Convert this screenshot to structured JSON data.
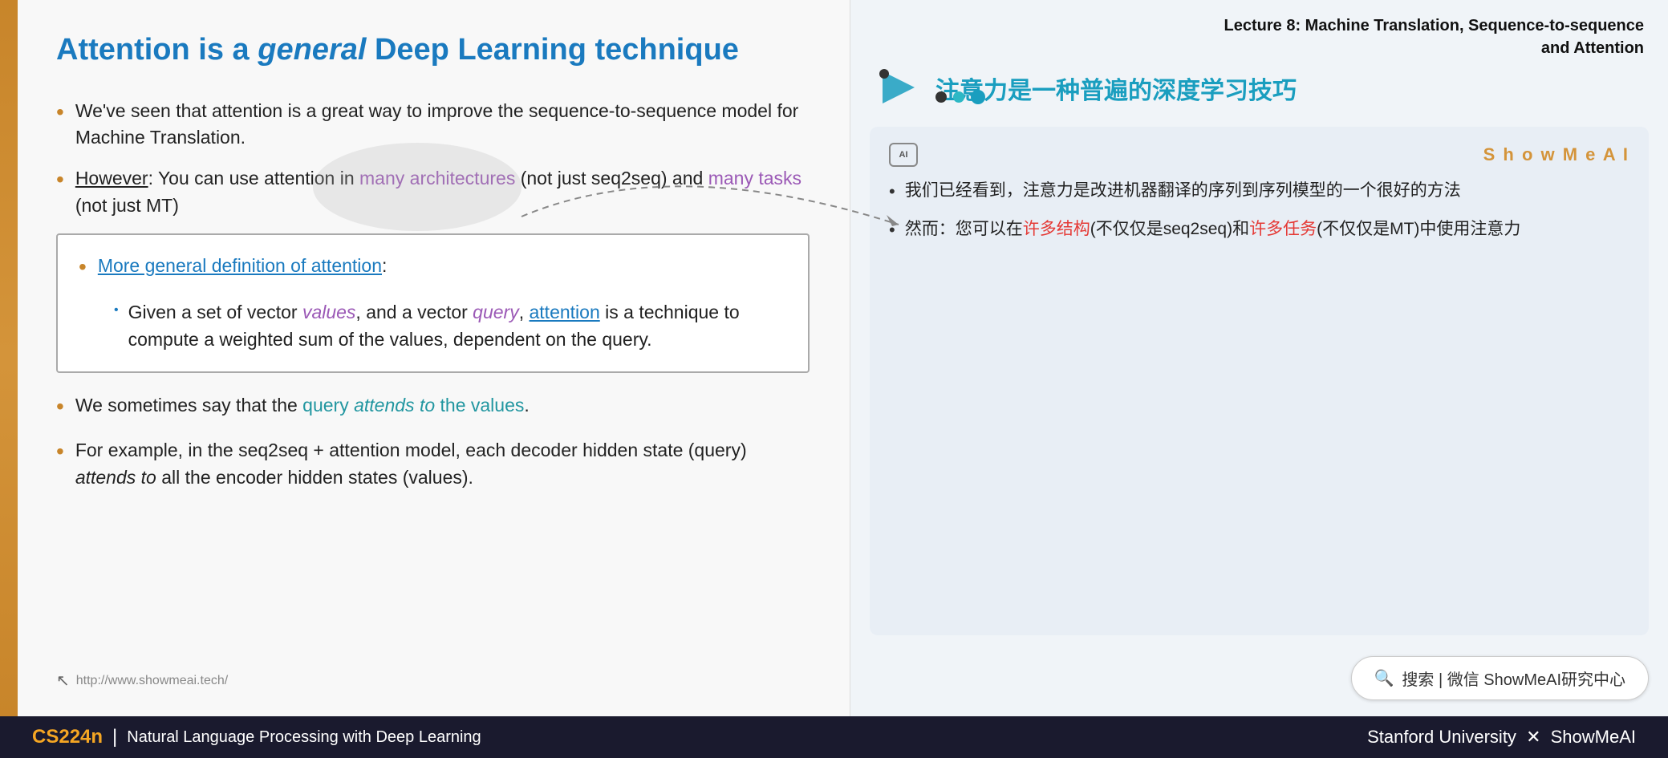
{
  "slide": {
    "left_bar_color": "#c8852a",
    "title": "Attention is a ",
    "title_italic": "general",
    "title_suffix": " Deep Learning technique",
    "bullets": [
      {
        "id": "bullet1",
        "text_parts": [
          {
            "text": "We've seen that attention is a great way to improve the sequence-to-sequence model for Machine Translation.",
            "style": "normal"
          }
        ]
      },
      {
        "id": "bullet2",
        "text_parts": [
          {
            "text": "However",
            "style": "underline"
          },
          {
            "text": ": You can use attention in ",
            "style": "normal"
          },
          {
            "text": "many architectures",
            "style": "purple"
          },
          {
            "text": " (not just seq2seq) and ",
            "style": "normal"
          },
          {
            "text": "many tasks",
            "style": "purple"
          },
          {
            "text": " (not just MT)",
            "style": "normal"
          }
        ]
      }
    ],
    "highlight_box": {
      "title": "More general definition of attention",
      "title_style": "blue-link",
      "colon": ":",
      "sub_bullet": "Given a set of vector ",
      "values_italic": "values",
      "mid_text": ", and a vector ",
      "query_italic": "query",
      "pre_attention": ", ",
      "attention_link": "attention",
      "post_text": " is a technique to compute a weighted sum of the values, dependent on the query."
    },
    "bullets2": [
      {
        "id": "bullet3",
        "pre": "We sometimes say that the ",
        "colored": "query ",
        "italic_colored": "attends to",
        "post": " the values",
        "period": "."
      },
      {
        "id": "bullet4",
        "text": "For example, in the seq2seq + attention model, each decoder hidden state (query) ",
        "italic": "attends to",
        "text2": " all the encoder hidden states (values)."
      }
    ],
    "url": "http://www.showmeai.tech/"
  },
  "right": {
    "lecture_line1": "Lecture 8:  Machine Translation, Sequence-to-sequence",
    "lecture_line2": "and Attention",
    "chinese_title": "注意力是一种普遍的深度学习技巧",
    "card": {
      "brand": "S h o w M e A I",
      "bullets": [
        {
          "text": "我们已经看到，注意力是改进机器翻译的序列到序列模型的一个很好的方法"
        },
        {
          "pre": "然而：您可以在",
          "red1": "许多结构",
          "mid": "(不仅仅是seq2seq)和",
          "red2": "许多任务",
          "post": "(不仅仅是MT)中使用注意力"
        }
      ]
    },
    "search": {
      "icon": "🔍",
      "text": "搜索 | 微信 ShowMeAI研究中心"
    }
  },
  "bottom_bar": {
    "cs_label": "CS224n",
    "separator": "|",
    "subtitle": "Natural Language Processing with Deep Learning",
    "right_text": "Stanford University",
    "x_mark": "✕",
    "brand": "ShowMeAI"
  }
}
